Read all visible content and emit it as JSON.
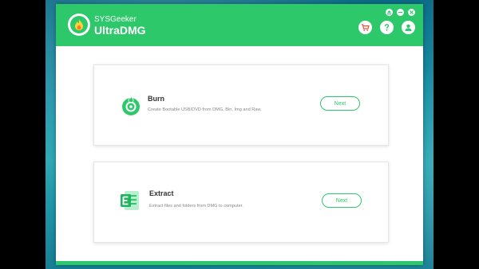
{
  "header": {
    "brand_small": "SYSGeeker",
    "brand_big": "UltraDMG",
    "accent": "#2dc86a",
    "window_controls": [
      "eject-icon",
      "minimize-icon",
      "close-icon"
    ],
    "icons": [
      "cart-icon",
      "help-icon",
      "user-icon"
    ]
  },
  "cards": {
    "burn": {
      "title": "Burn",
      "description": "Create Bootable USB/DVD from DMG, Bin, Img and Raw.",
      "button": "Next",
      "icon": "burn-disc-icon"
    },
    "extract": {
      "title": "Extract",
      "description": "Extract files and folders from DMG to computer.",
      "button": "Next",
      "icon": "extract-file-icon"
    }
  }
}
